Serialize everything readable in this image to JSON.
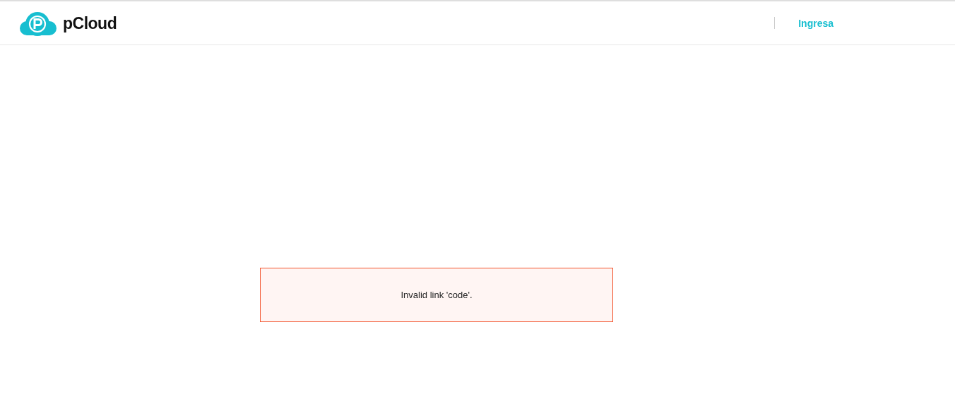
{
  "header": {
    "logo_text": "pCloud",
    "login_link": "Ingresa"
  },
  "error": {
    "message": "Invalid link 'code'."
  }
}
